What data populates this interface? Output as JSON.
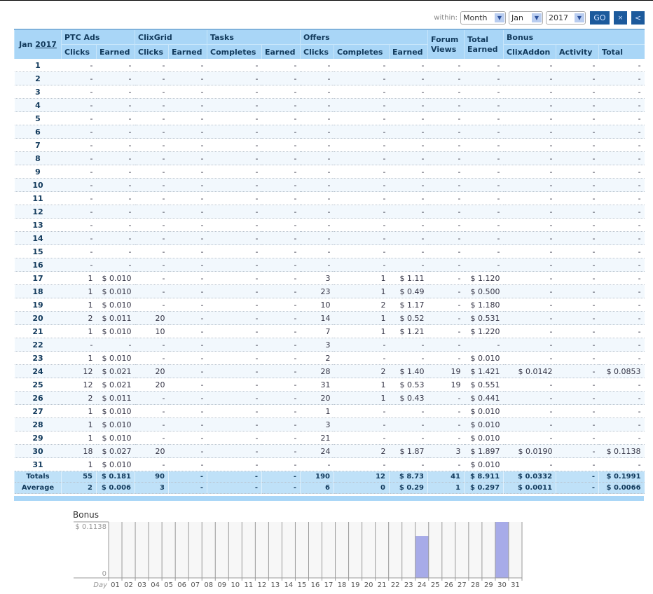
{
  "filters": {
    "within_label": "within:",
    "period": "Month",
    "month": "Jan",
    "year": "2017",
    "go_label": "GO",
    "close_label": "×",
    "back_label": "<"
  },
  "table": {
    "month": "Jan",
    "year": "2017",
    "groups": [
      "PTC Ads",
      "ClixGrid",
      "Tasks",
      "Offers",
      "Forum Views",
      "Total Earned",
      "Bonus"
    ],
    "subheaders": [
      "Clicks",
      "Earned",
      "Clicks",
      "Earned",
      "Completes",
      "Earned",
      "Clicks",
      "Completes",
      "Earned",
      "ClixAddon",
      "Activity",
      "Total"
    ],
    "rows": [
      [
        "1",
        "-",
        "-",
        "-",
        "-",
        "-",
        "-",
        "-",
        "-",
        "-",
        "-",
        "-",
        "-",
        "-",
        "-"
      ],
      [
        "2",
        "-",
        "-",
        "-",
        "-",
        "-",
        "-",
        "-",
        "-",
        "-",
        "-",
        "-",
        "-",
        "-",
        "-"
      ],
      [
        "3",
        "-",
        "-",
        "-",
        "-",
        "-",
        "-",
        "-",
        "-",
        "-",
        "-",
        "-",
        "-",
        "-",
        "-"
      ],
      [
        "4",
        "-",
        "-",
        "-",
        "-",
        "-",
        "-",
        "-",
        "-",
        "-",
        "-",
        "-",
        "-",
        "-",
        "-"
      ],
      [
        "5",
        "-",
        "-",
        "-",
        "-",
        "-",
        "-",
        "-",
        "-",
        "-",
        "-",
        "-",
        "-",
        "-",
        "-"
      ],
      [
        "6",
        "-",
        "-",
        "-",
        "-",
        "-",
        "-",
        "-",
        "-",
        "-",
        "-",
        "-",
        "-",
        "-",
        "-"
      ],
      [
        "7",
        "-",
        "-",
        "-",
        "-",
        "-",
        "-",
        "-",
        "-",
        "-",
        "-",
        "-",
        "-",
        "-",
        "-"
      ],
      [
        "8",
        "-",
        "-",
        "-",
        "-",
        "-",
        "-",
        "-",
        "-",
        "-",
        "-",
        "-",
        "-",
        "-",
        "-"
      ],
      [
        "9",
        "-",
        "-",
        "-",
        "-",
        "-",
        "-",
        "-",
        "-",
        "-",
        "-",
        "-",
        "-",
        "-",
        "-"
      ],
      [
        "10",
        "-",
        "-",
        "-",
        "-",
        "-",
        "-",
        "-",
        "-",
        "-",
        "-",
        "-",
        "-",
        "-",
        "-"
      ],
      [
        "11",
        "-",
        "-",
        "-",
        "-",
        "-",
        "-",
        "-",
        "-",
        "-",
        "-",
        "-",
        "-",
        "-",
        "-"
      ],
      [
        "12",
        "-",
        "-",
        "-",
        "-",
        "-",
        "-",
        "-",
        "-",
        "-",
        "-",
        "-",
        "-",
        "-",
        "-"
      ],
      [
        "13",
        "-",
        "-",
        "-",
        "-",
        "-",
        "-",
        "-",
        "-",
        "-",
        "-",
        "-",
        "-",
        "-",
        "-"
      ],
      [
        "14",
        "-",
        "-",
        "-",
        "-",
        "-",
        "-",
        "-",
        "-",
        "-",
        "-",
        "-",
        "-",
        "-",
        "-"
      ],
      [
        "15",
        "-",
        "-",
        "-",
        "-",
        "-",
        "-",
        "-",
        "-",
        "-",
        "-",
        "-",
        "-",
        "-",
        "-"
      ],
      [
        "16",
        "-",
        "-",
        "-",
        "-",
        "-",
        "-",
        "-",
        "-",
        "-",
        "-",
        "-",
        "-",
        "-",
        "-"
      ],
      [
        "17",
        "1",
        "$ 0.010",
        "-",
        "-",
        "-",
        "-",
        "3",
        "1",
        "$ 1.11",
        "-",
        "$ 1.120",
        "-",
        "-",
        "-"
      ],
      [
        "18",
        "1",
        "$ 0.010",
        "-",
        "-",
        "-",
        "-",
        "23",
        "1",
        "$ 0.49",
        "-",
        "$ 0.500",
        "-",
        "-",
        "-"
      ],
      [
        "19",
        "1",
        "$ 0.010",
        "-",
        "-",
        "-",
        "-",
        "10",
        "2",
        "$ 1.17",
        "-",
        "$ 1.180",
        "-",
        "-",
        "-"
      ],
      [
        "20",
        "2",
        "$ 0.011",
        "20",
        "-",
        "-",
        "-",
        "14",
        "1",
        "$ 0.52",
        "-",
        "$ 0.531",
        "-",
        "-",
        "-"
      ],
      [
        "21",
        "1",
        "$ 0.010",
        "10",
        "-",
        "-",
        "-",
        "7",
        "1",
        "$ 1.21",
        "-",
        "$ 1.220",
        "-",
        "-",
        "-"
      ],
      [
        "22",
        "-",
        "-",
        "-",
        "-",
        "-",
        "-",
        "3",
        "-",
        "-",
        "-",
        "-",
        "-",
        "-",
        "-"
      ],
      [
        "23",
        "1",
        "$ 0.010",
        "-",
        "-",
        "-",
        "-",
        "2",
        "-",
        "-",
        "-",
        "$ 0.010",
        "-",
        "-",
        "-"
      ],
      [
        "24",
        "12",
        "$ 0.021",
        "20",
        "-",
        "-",
        "-",
        "28",
        "2",
        "$ 1.40",
        "19",
        "$ 1.421",
        "$ 0.0142",
        "-",
        "$ 0.0853"
      ],
      [
        "25",
        "12",
        "$ 0.021",
        "20",
        "-",
        "-",
        "-",
        "31",
        "1",
        "$ 0.53",
        "19",
        "$ 0.551",
        "-",
        "-",
        "-"
      ],
      [
        "26",
        "2",
        "$ 0.011",
        "-",
        "-",
        "-",
        "-",
        "20",
        "1",
        "$ 0.43",
        "-",
        "$ 0.441",
        "-",
        "-",
        "-"
      ],
      [
        "27",
        "1",
        "$ 0.010",
        "-",
        "-",
        "-",
        "-",
        "1",
        "-",
        "-",
        "-",
        "$ 0.010",
        "-",
        "-",
        "-"
      ],
      [
        "28",
        "1",
        "$ 0.010",
        "-",
        "-",
        "-",
        "-",
        "3",
        "-",
        "-",
        "-",
        "$ 0.010",
        "-",
        "-",
        "-"
      ],
      [
        "29",
        "1",
        "$ 0.010",
        "-",
        "-",
        "-",
        "-",
        "21",
        "-",
        "-",
        "-",
        "$ 0.010",
        "-",
        "-",
        "-"
      ],
      [
        "30",
        "18",
        "$ 0.027",
        "20",
        "-",
        "-",
        "-",
        "24",
        "2",
        "$ 1.87",
        "3",
        "$ 1.897",
        "$ 0.0190",
        "-",
        "$ 0.1138"
      ],
      [
        "31",
        "1",
        "$ 0.010",
        "-",
        "-",
        "-",
        "-",
        "-",
        "-",
        "-",
        "-",
        "$ 0.010",
        "-",
        "-",
        "-"
      ]
    ],
    "totals": [
      "Totals",
      "55",
      "$ 0.181",
      "90",
      "-",
      "-",
      "-",
      "190",
      "12",
      "$ 8.73",
      "41",
      "$ 8.911",
      "$ 0.0332",
      "-",
      "$ 0.1991"
    ],
    "average": [
      "Average",
      "2",
      "$ 0.006",
      "3",
      "-",
      "-",
      "-",
      "6",
      "0",
      "$ 0.29",
      "1",
      "$ 0.297",
      "$ 0.0011",
      "-",
      "$ 0.0066"
    ]
  },
  "chart_data": {
    "type": "bar",
    "title": "Bonus",
    "xlabel": "Day",
    "categories": [
      "01",
      "02",
      "03",
      "04",
      "05",
      "06",
      "07",
      "08",
      "09",
      "10",
      "11",
      "12",
      "13",
      "14",
      "15",
      "16",
      "17",
      "18",
      "19",
      "20",
      "21",
      "22",
      "23",
      "24",
      "25",
      "26",
      "27",
      "28",
      "29",
      "30",
      "31"
    ],
    "values": [
      0,
      0,
      0,
      0,
      0,
      0,
      0,
      0,
      0,
      0,
      0,
      0,
      0,
      0,
      0,
      0,
      0,
      0,
      0,
      0,
      0,
      0,
      0,
      0.0853,
      0,
      0,
      0,
      0,
      0,
      0.1138,
      0
    ],
    "ylim": [
      0,
      0.1138
    ],
    "ytick_labels": [
      "$ 0.1138",
      "0"
    ],
    "bar_color": "#a7abe8",
    "grid": true
  }
}
